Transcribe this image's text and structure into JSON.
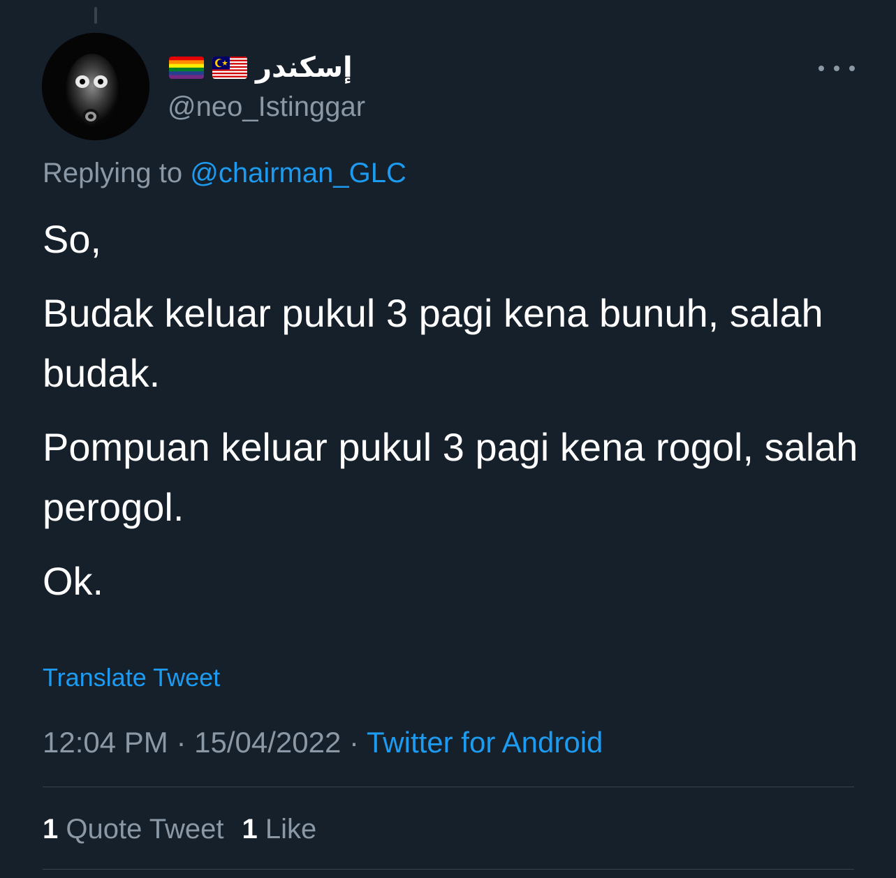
{
  "author": {
    "display_name": "إسكندر",
    "flags": [
      "rainbow-flag",
      "malaysia-flag"
    ],
    "handle": "@neo_Istinggar"
  },
  "reply": {
    "prefix": "Replying to",
    "mention": "@chairman_GLC"
  },
  "tweet": {
    "paragraphs": [
      "So,",
      "Budak keluar pukul 3 pagi kena bunuh, salah budak.",
      "Pompuan keluar pukul 3 pagi kena rogol, salah perogol.",
      "Ok."
    ],
    "translate_label": "Translate Tweet"
  },
  "meta": {
    "time": "12:04 PM",
    "separator": "·",
    "date": "15/04/2022",
    "source": "Twitter for Android"
  },
  "stats": {
    "quote_count": "1",
    "quote_label": "Quote Tweet",
    "like_count": "1",
    "like_label": "Like"
  },
  "colors": {
    "background": "#15202b",
    "accent": "#1d9bf0",
    "muted": "#8b98a5",
    "divider": "#38444d"
  }
}
